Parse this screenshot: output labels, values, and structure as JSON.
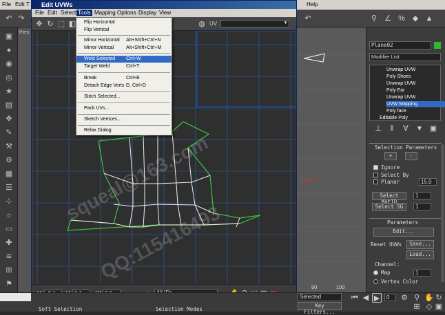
{
  "host": {
    "menu_left": [
      "File",
      "Edit",
      "T"
    ],
    "menu_right": "Help"
  },
  "window": {
    "title": "Edit UVWs",
    "menus": [
      "File",
      "Edit",
      "Select",
      "Tools",
      "Mapping",
      "Options",
      "Display",
      "View"
    ],
    "active_menu": "Tools",
    "toolbar_label": "UV",
    "viewport_label": "Pers"
  },
  "tools_menu": {
    "items": [
      {
        "label": "Flip Horizontal",
        "shortcut": ""
      },
      {
        "label": "Flip Vertical",
        "shortcut": ""
      },
      {
        "label": "Mirror Horizontal",
        "shortcut": "Alt+Shift+Ctrl+N"
      },
      {
        "label": "Mirror Vertical",
        "shortcut": "Alt+Shift+Ctrl+M"
      },
      {
        "label": "Weld Selected",
        "shortcut": "Ctrl+W"
      },
      {
        "label": "Target Weld",
        "shortcut": "Ctrl+T"
      },
      {
        "label": "Break",
        "shortcut": "Ctrl+B"
      },
      {
        "label": "Detach Edge Verts",
        "shortcut": "D, Ctrl+D"
      },
      {
        "label": "Stitch Selected...",
        "shortcut": ""
      },
      {
        "label": "Pack UVs...",
        "shortcut": ""
      },
      {
        "label": "Sketch Vertices...",
        "shortcut": ""
      },
      {
        "label": "Relax Dialog",
        "shortcut": ""
      }
    ],
    "highlighted": "Weld Selected"
  },
  "uv_bottom": {
    "u_label": "U:",
    "u_value": "-0.1",
    "v_label": "V:",
    "v_value": "0.1",
    "w_label": "W:",
    "w_value": "0.0",
    "map_select": "All IDs"
  },
  "watermark": {
    "line1": "squeal@163.com",
    "line2": "QQ:115416493"
  },
  "command_panel": {
    "object_name": "Plane02",
    "modifier_list": "Modifier List",
    "stack": [
      "Unwrap UVW",
      "Poly Shoes",
      "Unwrap UVW",
      "Poly Ear",
      "Unwrap UVW",
      "UVW Mapping",
      "Poly face",
      "Editable Poly"
    ],
    "selection_params_title": "Selection Parameters",
    "plus": "+",
    "minus": "-",
    "ignore": "Ignore",
    "select_by": "Select By",
    "planar": "Planar",
    "planar_value": "15.0",
    "select_matid": "Select MatID",
    "select_matid_value": "1",
    "select_sg": "Select SG",
    "select_sg_value": "1",
    "parameters_title": "Parameters",
    "edit_button": "Edit...",
    "reset_uvws": "Reset UVWs",
    "save_button": "Save...",
    "load_button": "Load...",
    "channel_label": "Channel:",
    "map_label": "Map",
    "map_value": "1",
    "vertex_color": "Vertex Color"
  },
  "status": {
    "soft_selection": "Soft Selection",
    "selection_modes": "Selection Modes",
    "selected": "Selected",
    "key_filters": "Key Filters...",
    "ruler_90": "90",
    "ruler_100": "100",
    "frame": "0"
  }
}
